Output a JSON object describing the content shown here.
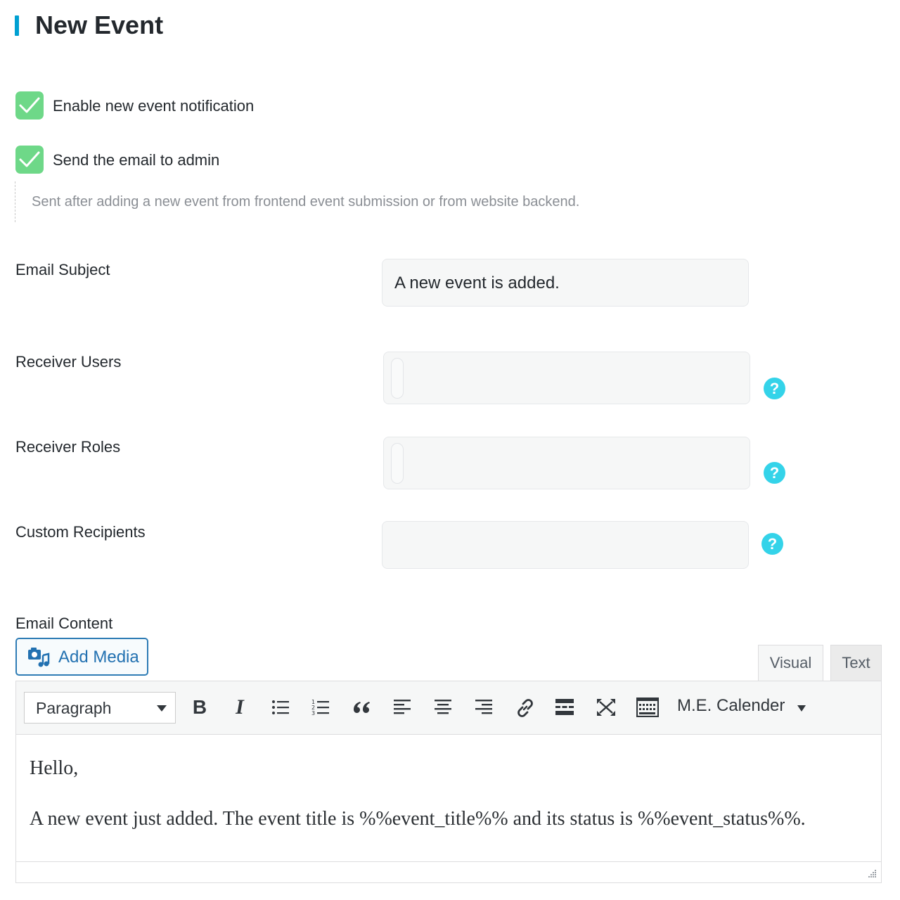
{
  "page": {
    "title": "New Event"
  },
  "options": {
    "enable_notification": {
      "label": "Enable new event notification",
      "checked": true
    },
    "send_to_admin": {
      "label": "Send the email to admin",
      "checked": true
    },
    "description": "Sent after adding a new event from frontend event submission or from website backend."
  },
  "fields": {
    "email_subject": {
      "label": "Email Subject",
      "value": "A new event is added."
    },
    "receiver_users": {
      "label": "Receiver Users",
      "value": ""
    },
    "receiver_roles": {
      "label": "Receiver Roles",
      "value": ""
    },
    "custom_recipients": {
      "label": "Custom Recipients",
      "value": ""
    },
    "help_glyph": "?"
  },
  "editor": {
    "label": "Email Content",
    "add_media": "Add Media",
    "tabs": {
      "visual": "Visual",
      "text": "Text"
    },
    "format_select": "Paragraph",
    "bold": "B",
    "italic": "I",
    "me_calendar": "M.E. Calender",
    "content": {
      "line1": "Hello,",
      "line2": "A new event just added. The event title is %%event_title%% and its status is %%event_status%%."
    }
  },
  "colors": {
    "accent": "#00a0d2",
    "checkbox": "#6ed888",
    "help": "#34d3e9",
    "link": "#2271b1"
  }
}
